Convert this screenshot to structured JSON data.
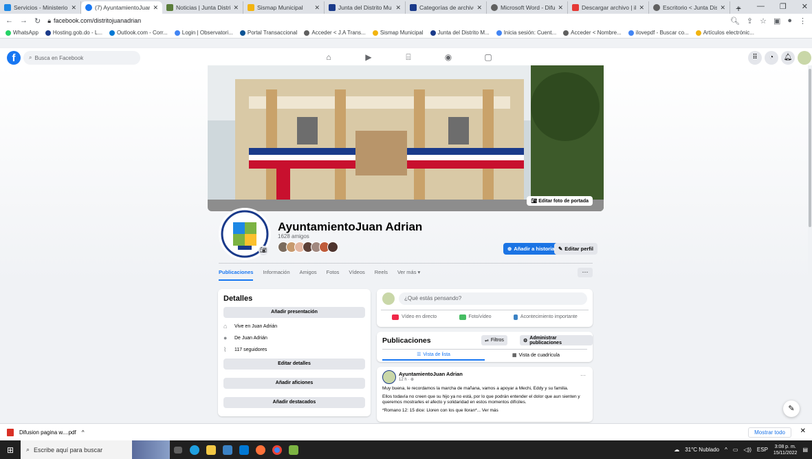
{
  "browser": {
    "tabs": [
      {
        "title": "Servicios - Ministerio",
        "color": "#1e88e5"
      },
      {
        "title": "(7) AyuntamientoJuan",
        "color": "#1877f2",
        "active": true
      },
      {
        "title": "Noticias | Junta Distrit",
        "color": "#5a7d3a"
      },
      {
        "title": "Sismap Municipal",
        "color": "#f2b40f"
      },
      {
        "title": "Junta del Distrito Mu",
        "color": "#1a3a8a"
      },
      {
        "title": "Categorías de archivo",
        "color": "#1a3a8a"
      },
      {
        "title": "Microsoft Word - Difu",
        "color": "#606060"
      },
      {
        "title": "Descargar archivo | il",
        "color": "#e53935"
      },
      {
        "title": "Escritorio < Junta Dis",
        "color": "#606060"
      }
    ],
    "new_tab": "+",
    "url": "facebook.com/distritojuanadrian",
    "bookmarks": [
      {
        "label": "WhatsApp",
        "color": "#25d366"
      },
      {
        "label": "Hosting.gob.do - L...",
        "color": "#1a3a8a"
      },
      {
        "label": "Outlook.com - Corr...",
        "color": "#0078d4"
      },
      {
        "label": "Login | Observatori...",
        "color": "#4285f4"
      },
      {
        "label": "Portal Transaccional",
        "color": "#0b5394"
      },
      {
        "label": "Acceder < J.A Trans...",
        "color": "#606060"
      },
      {
        "label": "Sismap Municipal",
        "color": "#f2b40f"
      },
      {
        "label": "Junta del Distrito M...",
        "color": "#1a3a8a"
      },
      {
        "label": "Inicia sesión: Cuent...",
        "color": "#4285f4"
      },
      {
        "label": "Acceder < Nombre...",
        "color": "#606060"
      },
      {
        "label": "ilovepdf - Buscar co...",
        "color": "#4285f4"
      },
      {
        "label": "Artículos electrónic...",
        "color": "#f2b40f"
      }
    ]
  },
  "fb": {
    "search_placeholder": "Busca en Facebook",
    "cover_button": "Editar foto de portada",
    "profile_name": "AyuntamientoJuan Adrian",
    "friends_count": "1628 amigos",
    "add_story": "Añadir a historia",
    "edit_profile": "Editar perfil",
    "tabs": [
      "Publicaciones",
      "Información",
      "Amigos",
      "Fotos",
      "Vídeos",
      "Reels",
      "Ver más ▾"
    ],
    "more_dots": "···",
    "details": {
      "title": "Detalles",
      "add_presentation": "Añadir presentación",
      "lives_in": "Vive en Juan Adrián",
      "from": "De Juan Adrián",
      "followers": "117 seguidores",
      "edit_details": "Editar detalles",
      "add_hobbies": "Añadir aficiones",
      "add_featured": "Añadir destacados"
    },
    "composer": {
      "placeholder": "¿Qué estás pensando?",
      "live": "Vídeo en directo",
      "photo": "Foto/vídeo",
      "event": "Acontecimiento importante"
    },
    "posts_header": {
      "title": "Publicaciones",
      "filters": "Filtros",
      "manage": "Administrar publicaciones",
      "list_view": "Vista de lista",
      "grid_view": "Vista de cuadrícula"
    },
    "post": {
      "author": "AyuntamientoJuan Adrian",
      "time": "12 h · ",
      "p1": "Muy buena, le recordamos la marcha de mañana, vamos a apoyar a Mechi, Eddy y su familia.",
      "p2": "Ellos todavía no creen que su hijo ya no está, por lo que podrán entender el dolor que aun sienten y queremos mostrarles el afecto y solidaridad en estos momentos difíciles.",
      "p3": "*Romano 12: 15 dice: Lloren con los que lloran*... Ver más",
      "dots": "···"
    }
  },
  "downloads": {
    "file": "Difusion pagina w....pdf",
    "expand": "^",
    "show_all": "Mostrar todo",
    "close": "✕"
  },
  "taskbar": {
    "search": "Escribe aquí para buscar",
    "weather": "31°C Nublado",
    "lang": "ESP",
    "time": "3:08 p. m.",
    "date": "15/11/2022"
  }
}
